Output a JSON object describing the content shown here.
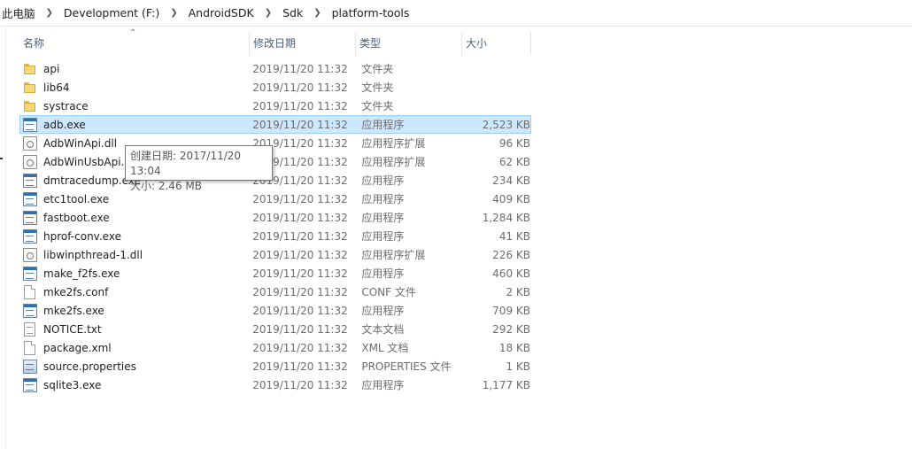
{
  "breadcrumb": [
    "此电脑",
    "Development (F:)",
    "AndroidSDK",
    "Sdk",
    "platform-tools"
  ],
  "columns": {
    "name": "名称",
    "date": "修改日期",
    "type": "类型",
    "size": "大小"
  },
  "files": [
    {
      "name": "api",
      "date": "2019/11/20 11:32",
      "type": "文件夹",
      "size": "",
      "icon": "folder-icon"
    },
    {
      "name": "lib64",
      "date": "2019/11/20 11:32",
      "type": "文件夹",
      "size": "",
      "icon": "folder-icon"
    },
    {
      "name": "systrace",
      "date": "2019/11/20 11:32",
      "type": "文件夹",
      "size": "",
      "icon": "folder-icon"
    },
    {
      "name": "adb.exe",
      "date": "2019/11/20 11:32",
      "type": "应用程序",
      "size": "2,523 KB",
      "icon": "exe-icon",
      "selected": true
    },
    {
      "name": "AdbWinApi.dll",
      "date": "2019/11/20 11:32",
      "type": "应用程序扩展",
      "size": "96 KB",
      "icon": "dll-icon"
    },
    {
      "name": "AdbWinUsbApi.dll",
      "date": "2019/11/20 11:32",
      "type": "应用程序扩展",
      "size": "62 KB",
      "icon": "dll-icon"
    },
    {
      "name": "dmtracedump.exe",
      "date": "2019/11/20 11:32",
      "type": "应用程序",
      "size": "234 KB",
      "icon": "exe-icon"
    },
    {
      "name": "etc1tool.exe",
      "date": "2019/11/20 11:32",
      "type": "应用程序",
      "size": "409 KB",
      "icon": "exe-icon"
    },
    {
      "name": "fastboot.exe",
      "date": "2019/11/20 11:32",
      "type": "应用程序",
      "size": "1,284 KB",
      "icon": "exe-icon"
    },
    {
      "name": "hprof-conv.exe",
      "date": "2019/11/20 11:32",
      "type": "应用程序",
      "size": "41 KB",
      "icon": "exe-icon"
    },
    {
      "name": "libwinpthread-1.dll",
      "date": "2019/11/20 11:32",
      "type": "应用程序扩展",
      "size": "226 KB",
      "icon": "dll-icon"
    },
    {
      "name": "make_f2fs.exe",
      "date": "2019/11/20 11:32",
      "type": "应用程序",
      "size": "460 KB",
      "icon": "exe-icon"
    },
    {
      "name": "mke2fs.conf",
      "date": "2019/11/20 11:32",
      "type": "CONF 文件",
      "size": "2 KB",
      "icon": "file-icon"
    },
    {
      "name": "mke2fs.exe",
      "date": "2019/11/20 11:32",
      "type": "应用程序",
      "size": "709 KB",
      "icon": "exe-icon"
    },
    {
      "name": "NOTICE.txt",
      "date": "2019/11/20 11:32",
      "type": "文本文档",
      "size": "292 KB",
      "icon": "text-file-icon"
    },
    {
      "name": "package.xml",
      "date": "2019/11/20 11:32",
      "type": "XML 文档",
      "size": "18 KB",
      "icon": "file-icon"
    },
    {
      "name": "source.properties",
      "date": "2019/11/20 11:32",
      "type": "PROPERTIES 文件",
      "size": "1 KB",
      "icon": "properties-file-icon"
    },
    {
      "name": "sqlite3.exe",
      "date": "2019/11/20 11:32",
      "type": "应用程序",
      "size": "1,177 KB",
      "icon": "exe-icon"
    }
  ],
  "tooltip": {
    "line1": "创建日期: 2017/11/20 13:04",
    "line2": "大小: 2.46 MB"
  },
  "colors": {
    "selection_bg": "#cce8ff",
    "selection_border": "#99d1ff",
    "header_text": "#4c607a",
    "folder": "#f8d775"
  }
}
